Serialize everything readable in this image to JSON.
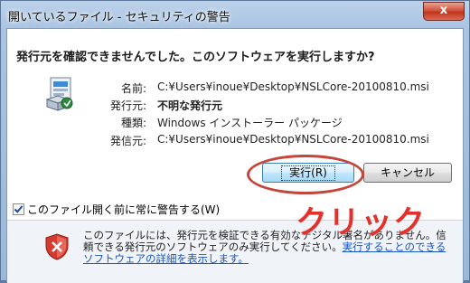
{
  "window": {
    "title": "開いているファイル - セキュリティの警告",
    "close_glyph": "x"
  },
  "dialog": {
    "question": "発行元を確認できませんでした。このソフトウェアを実行しますか?",
    "icon": "installer-package-icon",
    "fields": [
      {
        "label": "名前:",
        "value": "C:¥Users¥inoue¥Desktop¥NSLCore-20100810.msi"
      },
      {
        "label": "発行元:",
        "value": "不明な発行元"
      },
      {
        "label": "種類:",
        "value": "Windows インストーラー パッケージ"
      },
      {
        "label": "発信元:",
        "value": "C:¥Users¥inoue¥Desktop¥NSLCore-20100810.msi"
      }
    ],
    "buttons": {
      "run": "実行(R)",
      "cancel": "キャンセル"
    },
    "checkbox": {
      "label": "このファイル開く前に常に警告する(W)",
      "checked": true
    }
  },
  "footer": {
    "icon": "warning-shield-icon",
    "text": "このファイルには、発行元を検証できる有効なデジタル署名がありません。信頼できる発行元のソフトウェアのみ実行してください。",
    "link": "実行することのできるソフトウェアの詳細を表示します。"
  },
  "annotation": {
    "text": "クリック",
    "color": "#e2322d"
  }
}
